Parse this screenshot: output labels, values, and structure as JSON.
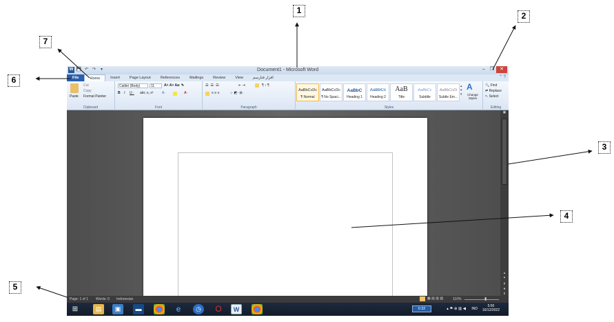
{
  "callouts": [
    "1",
    "2",
    "3",
    "4",
    "5",
    "6",
    "7"
  ],
  "window": {
    "title": "Document1 - Microsoft Word",
    "qat": [
      "W",
      "💾",
      "↶",
      "↷",
      "▾"
    ],
    "controls": [
      "–",
      "❐",
      "✕"
    ]
  },
  "tabs": [
    "File",
    "Home",
    "Insert",
    "Page Layout",
    "References",
    "Mailings",
    "Review",
    "View",
    "افزار فتارسم"
  ],
  "ribbon": {
    "clipboard": {
      "paste": "Paste",
      "cut": "Cut",
      "copy": "Copy",
      "format_painter": "Format Painter",
      "label": "Clipboard"
    },
    "font": {
      "name": "Calibri (Body)",
      "size": "11",
      "label": "Font"
    },
    "paragraph": {
      "label": "Paragraph"
    },
    "styles": {
      "items": [
        {
          "preview": "AaBbCcDc",
          "name": "¶ Normal"
        },
        {
          "preview": "AaBbCcDc",
          "name": "¶ No Spaci..."
        },
        {
          "preview": "AaBbC",
          "name": "Heading 1"
        },
        {
          "preview": "AaBbCc",
          "name": "Heading 2"
        },
        {
          "preview": "AaB",
          "name": "Title"
        },
        {
          "preview": "AaBbCc",
          "name": "Subtitle"
        },
        {
          "preview": "AaBbCcDi",
          "name": "Subtle Em..."
        }
      ],
      "change": "Change Styles",
      "label": "Styles"
    },
    "editing": {
      "find": "Find",
      "replace": "Replace",
      "select": "Select",
      "label": "Editing"
    }
  },
  "status": {
    "page": "Page: 1 of 1",
    "words": "Words: 0",
    "language": "Indonesian",
    "zoom": "110%"
  },
  "taskbar": {
    "time_box": "0:32",
    "lang": "IND",
    "clock": "5:50",
    "date": "16/12/2022"
  }
}
